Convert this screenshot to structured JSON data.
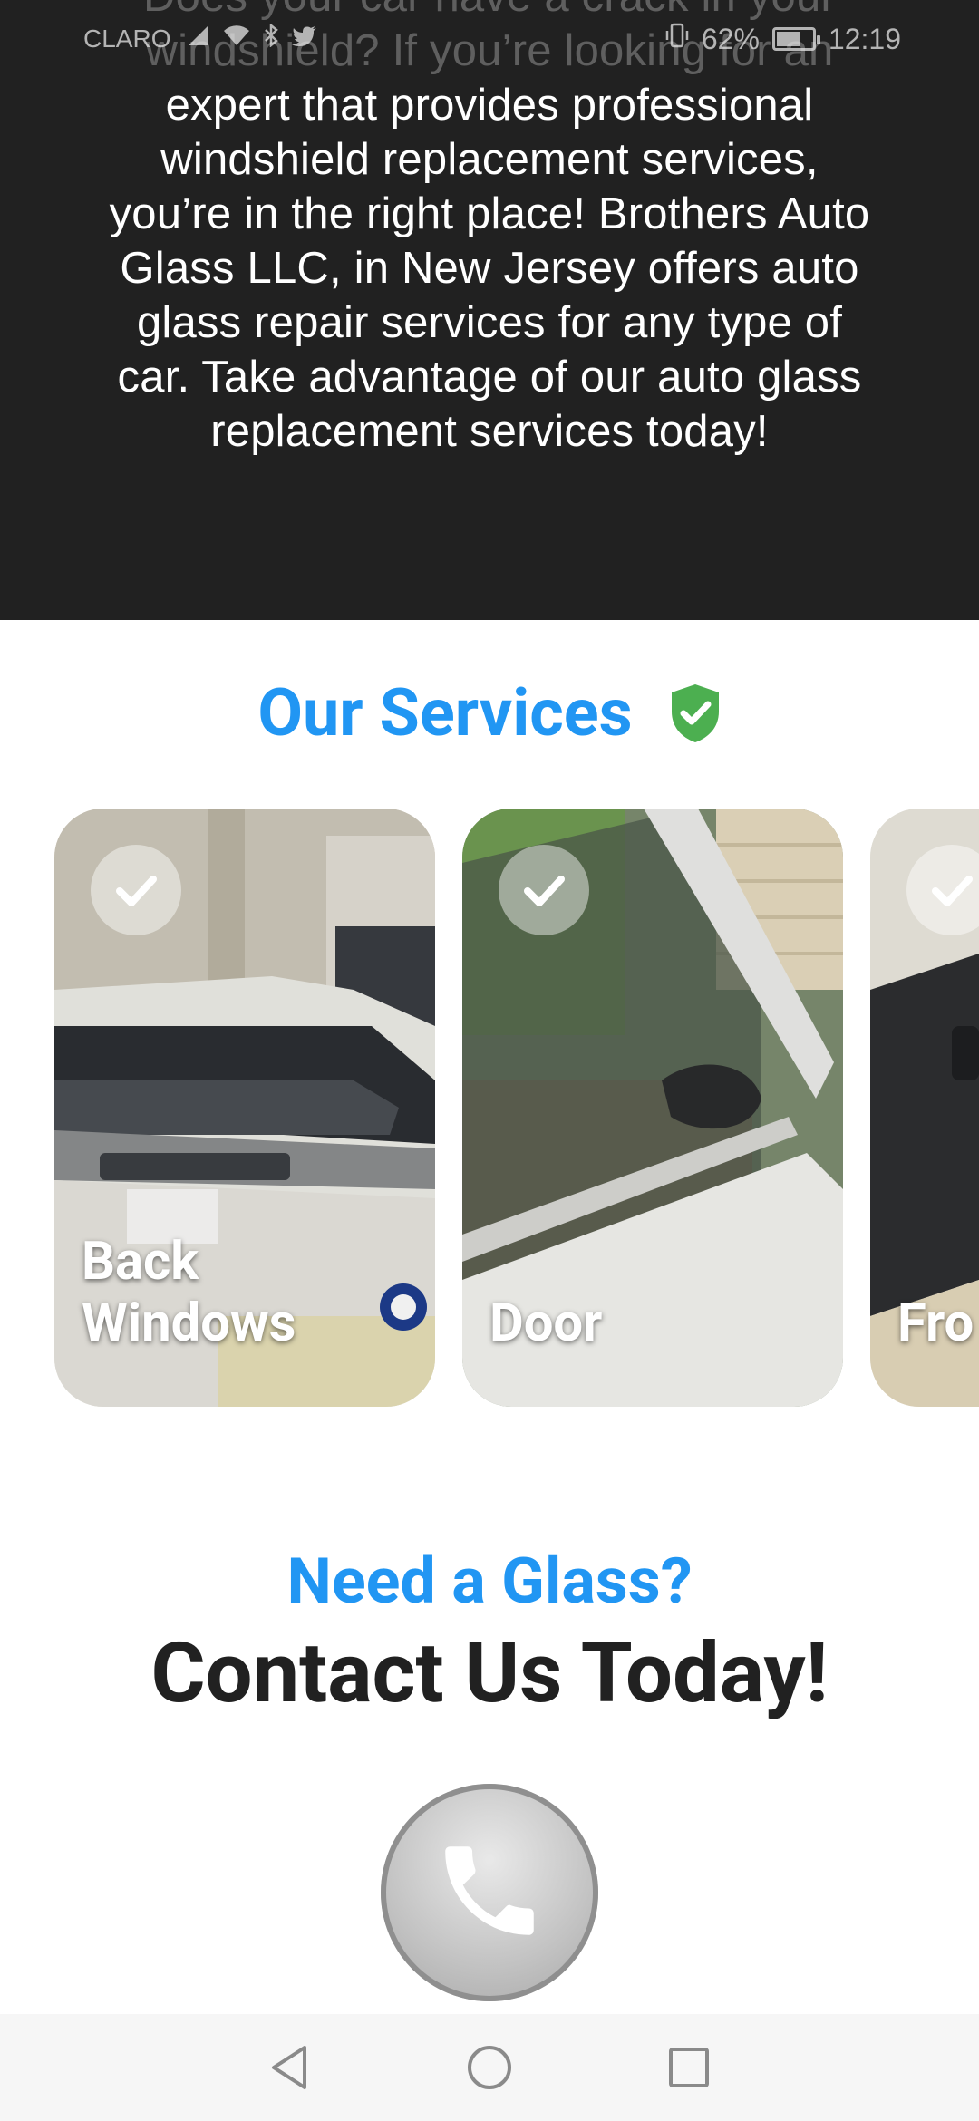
{
  "status_bar": {
    "carrier": "CLARO",
    "battery": "62%",
    "battery_level": 0.62,
    "time": "12:19",
    "icons": [
      "signal-icon",
      "wifi-icon",
      "bluetooth-icon",
      "twitter-icon",
      "vibrate-icon",
      "battery-icon"
    ]
  },
  "hero": {
    "text": "Does your car have a crack in your windshield? If you’re looking for an expert that provides professional windshield replacement services, you’re in the right place! Brothers Auto Glass LLC, in New Jersey offers auto glass repair services for any type of car. Take advantage of our auto glass replacement services today!"
  },
  "services": {
    "title": "Our Services",
    "title_icon": "shield-check-icon",
    "cards": [
      {
        "label": "Back Windows",
        "icon": "check-icon"
      },
      {
        "label": "Door",
        "icon": "check-icon"
      },
      {
        "label": "Fro",
        "icon": "check-icon"
      }
    ]
  },
  "contact": {
    "subtitle": "Need a Glass?",
    "title": "Contact Us Today!",
    "call_icon": "phone-icon"
  },
  "nav": {
    "icons": [
      "back-icon",
      "home-icon",
      "recents-icon"
    ]
  },
  "colors": {
    "accent": "#2196f3",
    "hero_bg": "#212121",
    "shield_green": "#4caf50",
    "heading_dark": "#212121"
  }
}
